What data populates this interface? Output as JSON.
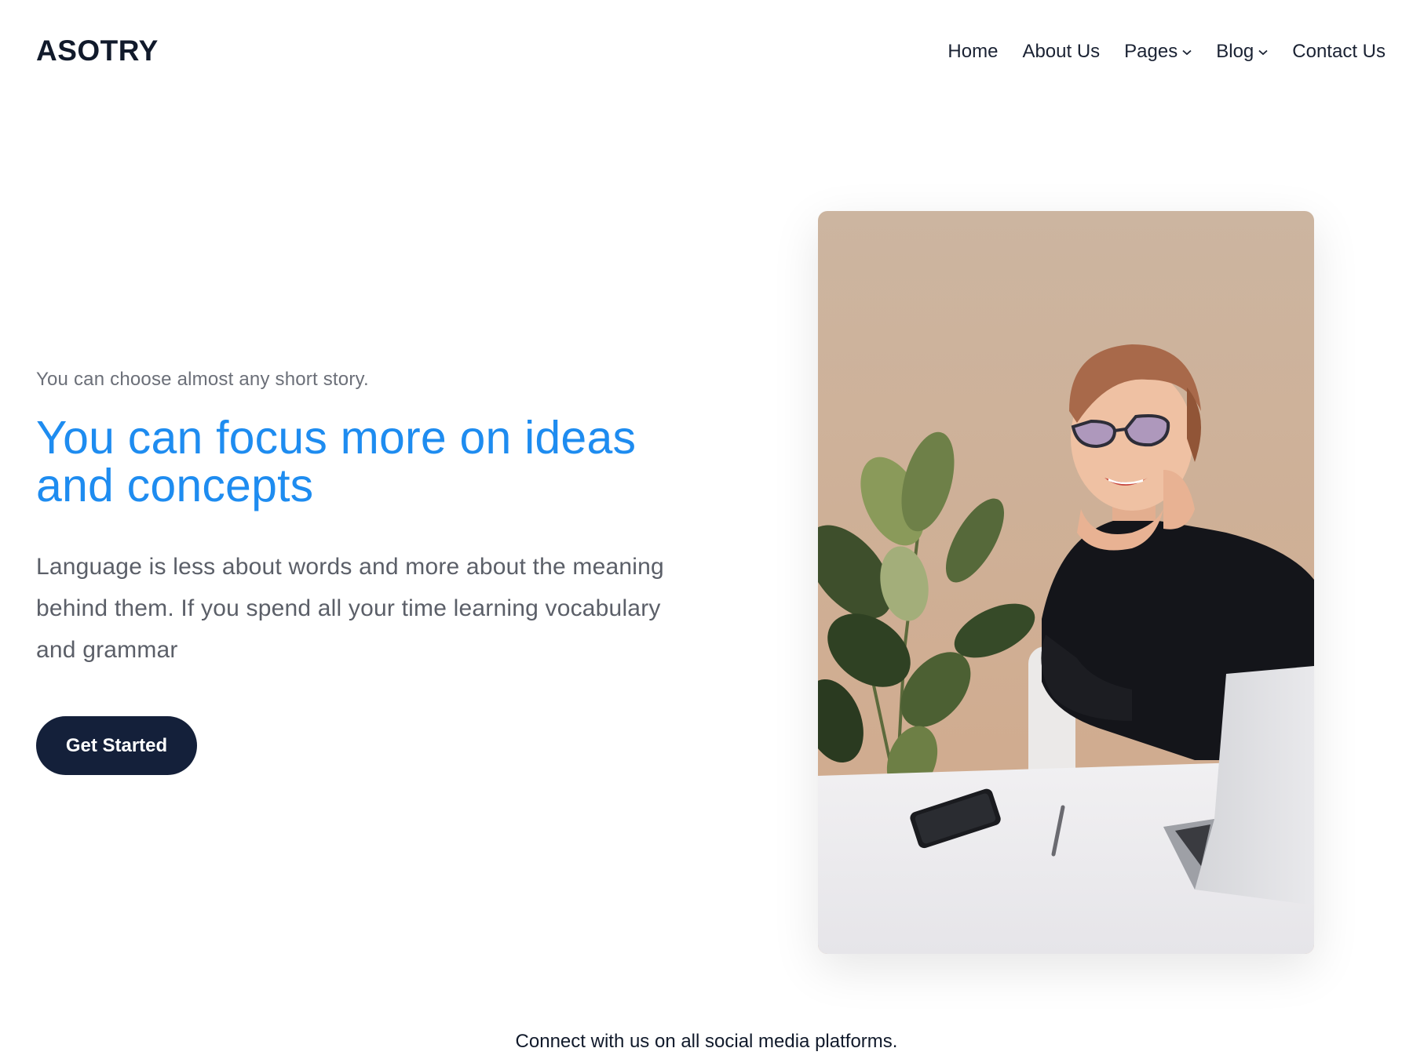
{
  "brand": {
    "name": "ASOTRY"
  },
  "nav": {
    "items": [
      {
        "label": "Home",
        "has_dropdown": false
      },
      {
        "label": "About Us",
        "has_dropdown": false
      },
      {
        "label": "Pages",
        "has_dropdown": true
      },
      {
        "label": "Blog",
        "has_dropdown": true
      },
      {
        "label": "Contact Us",
        "has_dropdown": false
      }
    ]
  },
  "hero": {
    "eyebrow": "You can choose almost any short story.",
    "headline": "You can focus more on ideas and concepts",
    "body": "Language is less about words and more about the meaning behind them. If you spend all your time learning vocabulary and grammar",
    "cta_label": "Get Started"
  },
  "footer": {
    "tagline": "Connect with us on all social media platforms."
  },
  "colors": {
    "accent": "#1e8cf0",
    "dark": "#14203a",
    "muted": "#6b6f78"
  },
  "icons": {
    "dropdown": "chevron-down-icon"
  }
}
